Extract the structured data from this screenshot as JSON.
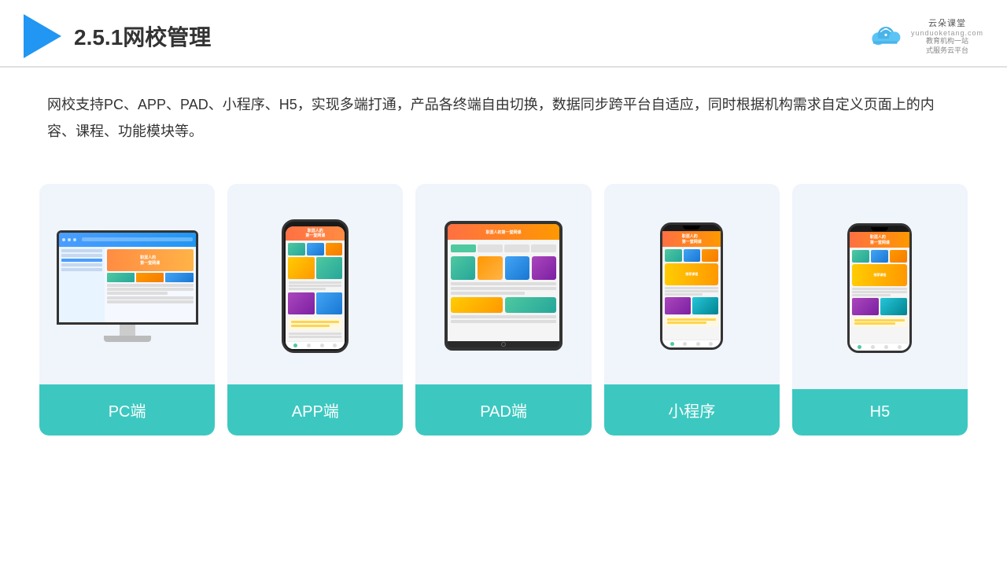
{
  "header": {
    "section_number": "2.5.1",
    "title": "网校管理",
    "brand": {
      "name": "云朵课堂",
      "url": "yunduoketang.com",
      "tagline": "教育机构一站\n式服务云平台"
    }
  },
  "description": "网校支持PC、APP、PAD、小程序、H5，实现多端打通，产品各终端自由切换，数据同步跨平台自适应，同时根据机构需求自定义页面上的内容、课程、功能模块等。",
  "devices": [
    {
      "id": "pc",
      "label": "PC端"
    },
    {
      "id": "app",
      "label": "APP端"
    },
    {
      "id": "pad",
      "label": "PAD端"
    },
    {
      "id": "miniprogram",
      "label": "小程序"
    },
    {
      "id": "h5",
      "label": "H5"
    }
  ],
  "colors": {
    "card_bg": "#eef2fb",
    "label_bg": "#3CC8C0",
    "label_text": "#ffffff",
    "accent_blue": "#2196F3",
    "accent_orange": "#ff8c42",
    "accent_teal": "#4ec9a0",
    "title_color": "#333333",
    "divider": "#e0e0e0"
  }
}
